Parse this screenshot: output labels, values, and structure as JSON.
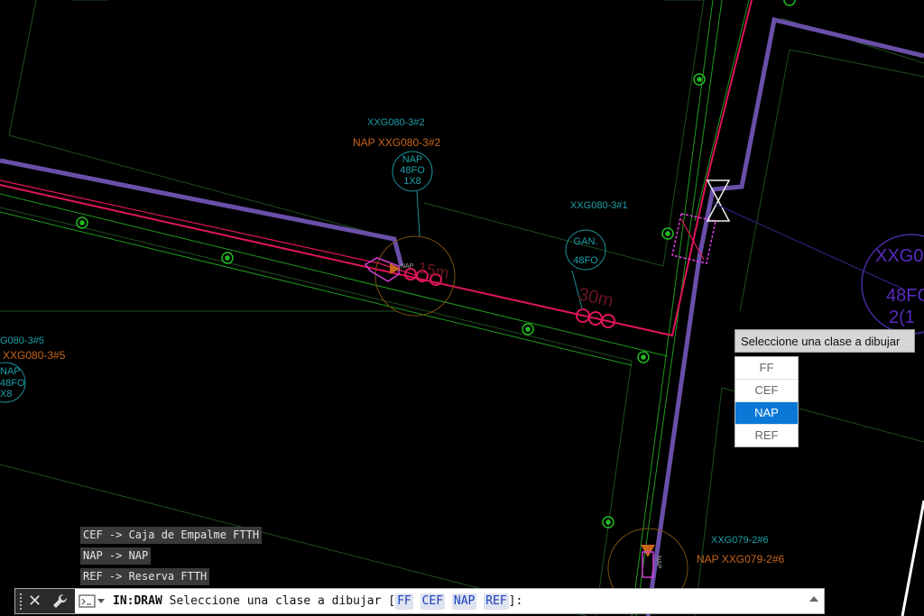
{
  "drawing": {
    "labels": {
      "nap2_id": "XXG080-3#2",
      "nap2_title": "NAP XXG080-3#2",
      "nap2_symbol": [
        "NAP",
        "48FO",
        "1X8"
      ],
      "nap2_small": "NAP",
      "span_15m": "15m",
      "xxg1_id": "XXG080-3#1",
      "gan_symbol": [
        "GAN.",
        "48FO"
      ],
      "span_30m": "30m",
      "left_id": "G080-3#5",
      "left_title": "XXG080-3#5",
      "left_symbol": [
        "NAP",
        "48FO",
        "X8"
      ],
      "right_big": [
        "XXG0",
        "48FO",
        "2(1"
      ],
      "bottom_id": "XXG079-2#6",
      "bottom_title": "NAP XXG079-2#6",
      "bottom_small": "NAP"
    },
    "colors": {
      "background": "#000000",
      "outline": "#1f5a1f",
      "green_line": "#22aa22",
      "purple_cable": "#6a4fa8",
      "red_cable": "#e0155a",
      "cyan_text": "#1aa0a8",
      "orange_text": "#c8641a",
      "magenta": "#e040e0",
      "big_purple": "#6a2fd0"
    }
  },
  "tooltip": "Seleccione una clase a dibujar",
  "options": [
    {
      "label": "FF",
      "selected": false
    },
    {
      "label": "CEF",
      "selected": false
    },
    {
      "label": "NAP",
      "selected": true
    },
    {
      "label": "REF",
      "selected": false
    }
  ],
  "history": [
    "CEF -> Caja de Empalme FTTH",
    "NAP -> NAP",
    "REF -> Reserva FTTH"
  ],
  "command": {
    "close": "✕",
    "mode": "IN:DRAW",
    "prompt": "Seleccione una clase a dibujar [",
    "keywords": [
      "FF",
      "CEF",
      "NAP",
      "REF"
    ],
    "suffix": "]:"
  }
}
